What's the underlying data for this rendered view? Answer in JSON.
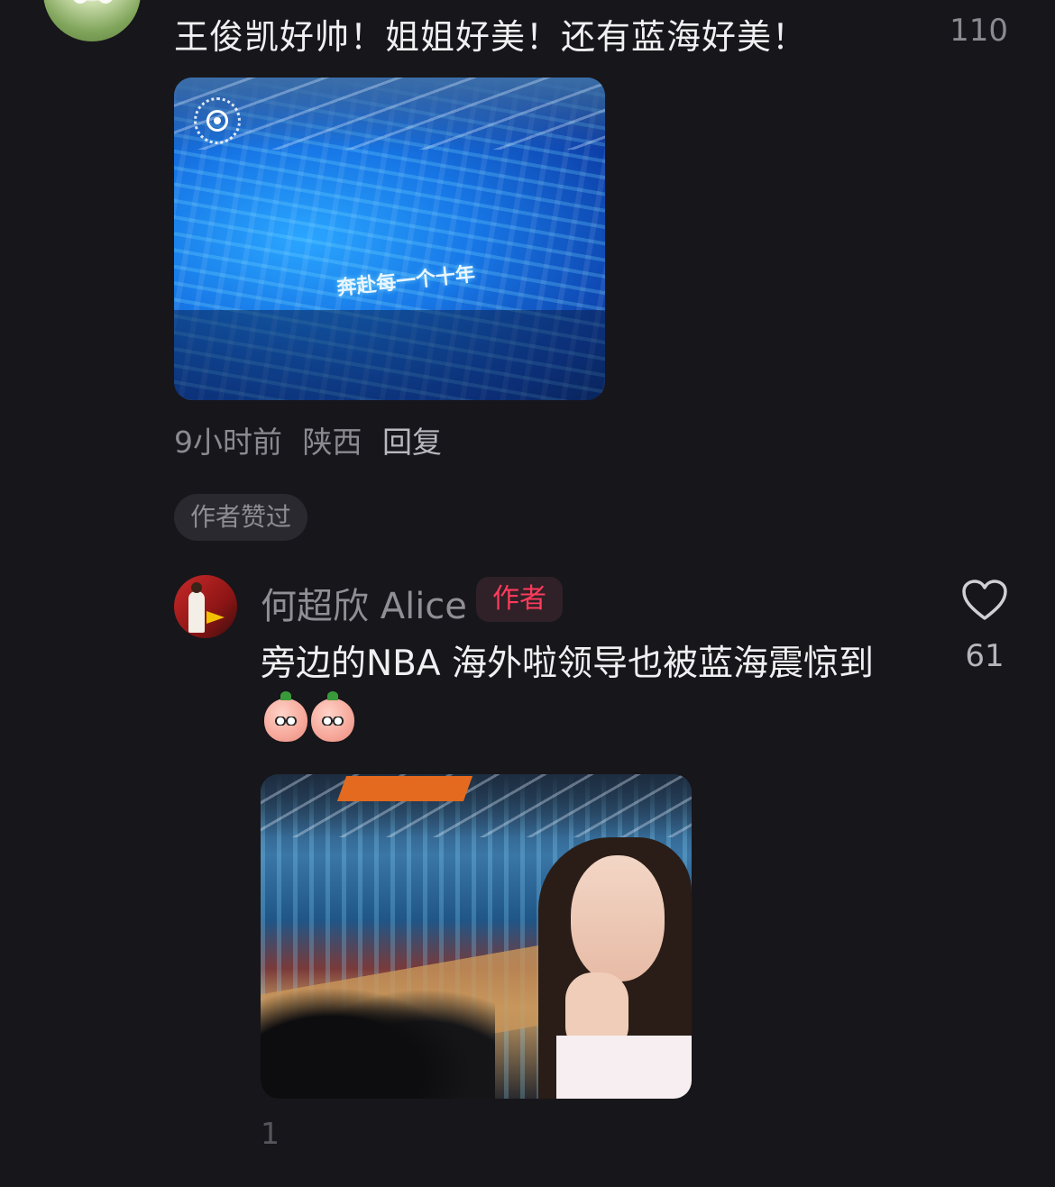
{
  "comment1": {
    "text": "王俊凯好帅！姐姐好美！还有蓝海好美！",
    "likes": "110",
    "image_overlay_text": "奔赴每一个十年",
    "time": "9小时前",
    "location": "陕西",
    "reply_label": "回复",
    "author_liked_badge": "作者赞过"
  },
  "comment2": {
    "author_name": "何超欣 Alice",
    "author_tag": "作者",
    "text": "旁边的NBA 海外啦领导也被蓝海震惊到",
    "emojis": [
      "peach-face-emoji",
      "peach-face-emoji"
    ],
    "likes": "61",
    "meta_partial": "1"
  },
  "colors": {
    "background": "#17161b",
    "author_tag": "#ff3b5c",
    "muted_text": "#8a8a90"
  }
}
